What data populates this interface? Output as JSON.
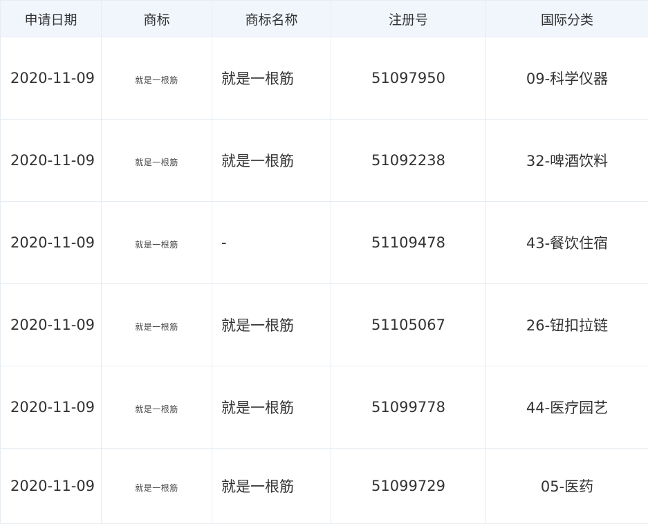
{
  "table": {
    "headers": [
      "申请日期",
      "商标",
      "商标名称",
      "注册号",
      "国际分类"
    ],
    "rows": [
      {
        "date": "2020-11-09",
        "mark_text": "就是一根筋",
        "name": "就是一根筋",
        "reg_no": "51097950",
        "class": "09-科学仪器"
      },
      {
        "date": "2020-11-09",
        "mark_text": "就是一根筋",
        "name": "就是一根筋",
        "reg_no": "51092238",
        "class": "32-啤酒饮料"
      },
      {
        "date": "2020-11-09",
        "mark_text": "就是一根筋",
        "name": "-",
        "reg_no": "51109478",
        "class": "43-餐饮住宿"
      },
      {
        "date": "2020-11-09",
        "mark_text": "就是一根筋",
        "name": "就是一根筋",
        "reg_no": "51105067",
        "class": "26-钮扣拉链"
      },
      {
        "date": "2020-11-09",
        "mark_text": "就是一根筋",
        "name": "就是一根筋",
        "reg_no": "51099778",
        "class": "44-医疗园艺"
      },
      {
        "date": "2020-11-09",
        "mark_text": "就是一根筋",
        "name": "就是一根筋",
        "reg_no": "51099729",
        "class": "05-医药"
      }
    ]
  }
}
